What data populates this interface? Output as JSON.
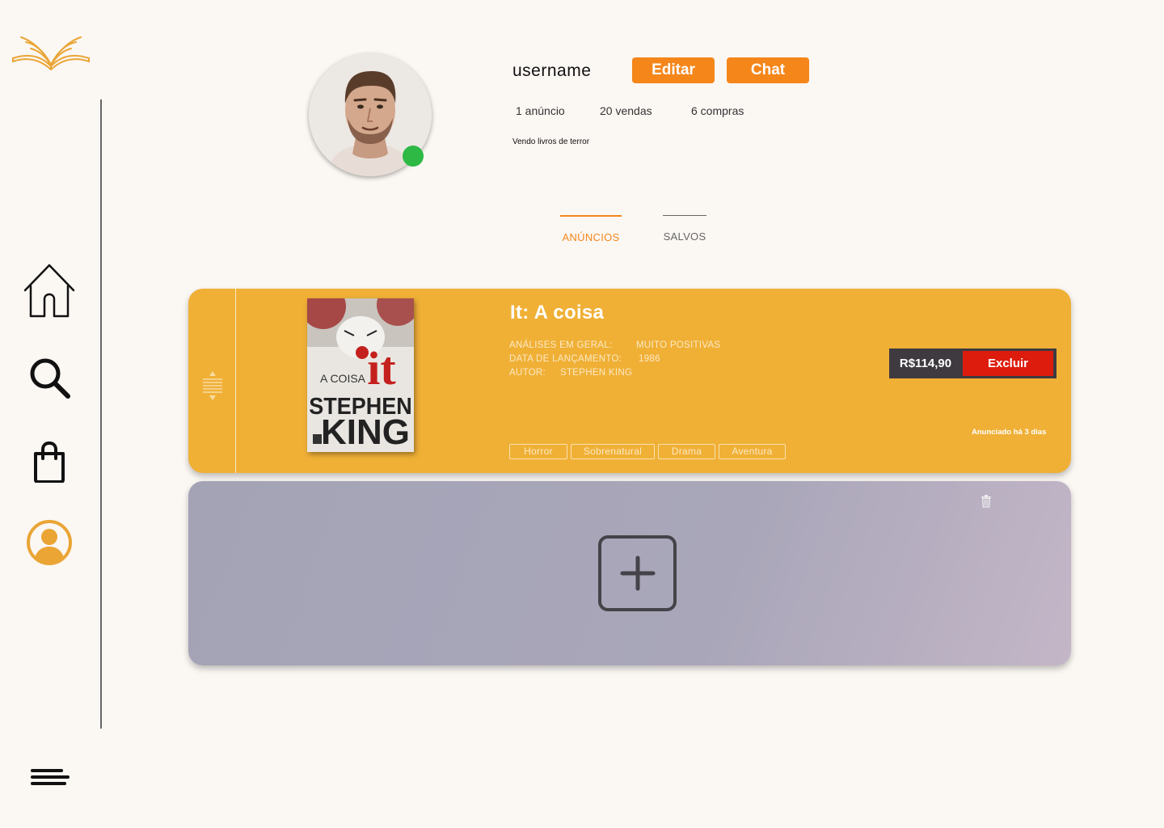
{
  "profile": {
    "username": "username",
    "edit_label": "Editar",
    "chat_label": "Chat",
    "stats": {
      "listings": "1 anúncio",
      "sales": "20 vendas",
      "purchases": "6 compras"
    },
    "bio": "Vendo livros  de terror",
    "online": true
  },
  "tabs": [
    {
      "label": "ANÚNCIOS",
      "active": true
    },
    {
      "label": "SALVOS",
      "active": false
    }
  ],
  "listing": {
    "title": "It: A coisa",
    "reviews_label": "ANÁLISES EM GERAL:",
    "reviews_value": "MUITO POSITIVAS",
    "release_label": "DATA DE LANÇAMENTO:",
    "release_value": "1986",
    "author_label": "AUTOR:",
    "author_value": "STEPHEN KING",
    "price": "R$114,90",
    "delete_label": "Excluir",
    "posted": "Anunciado há 3 dias",
    "tags": [
      "Horror",
      "Sobrenatural",
      "Drama",
      "Aventura"
    ],
    "cover": {
      "top_text": "A COISA",
      "logo_text": "it",
      "author_line1": "STEPHEN",
      "author_line2": "KING"
    }
  },
  "sidebar": {
    "items": [
      {
        "icon": "home-icon"
      },
      {
        "icon": "search-icon"
      },
      {
        "icon": "shopping-bag-icon"
      },
      {
        "icon": "profile-icon",
        "active": true
      }
    ]
  },
  "colors": {
    "accent": "#f5861a",
    "card": "#f0b036",
    "danger": "#dd1c0d",
    "online": "#2db944"
  }
}
